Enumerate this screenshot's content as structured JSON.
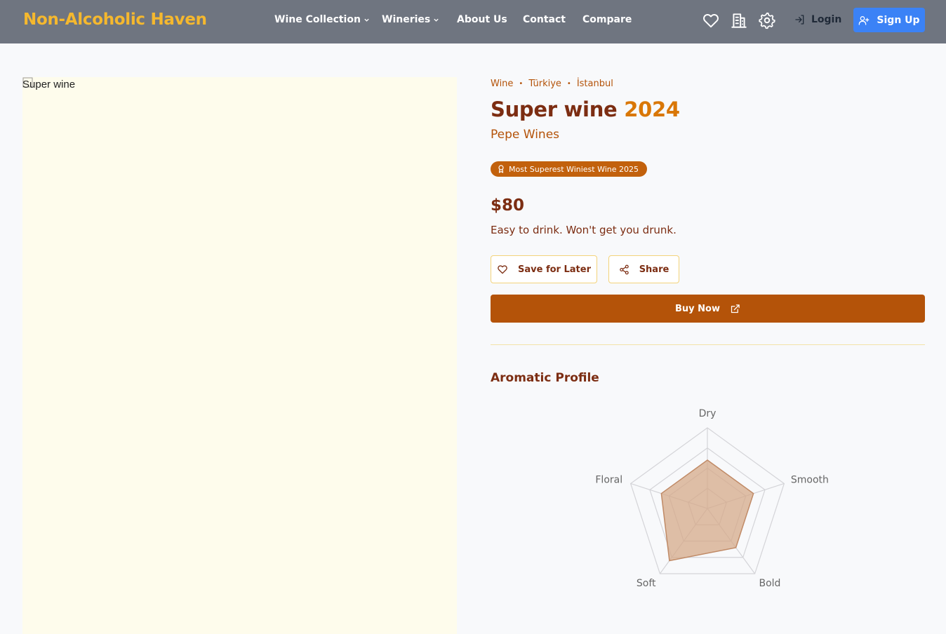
{
  "header": {
    "brand": "Non-Alcoholic Haven",
    "nav": [
      {
        "label": "Wine Collection",
        "dropdown": true
      },
      {
        "label": "Wineries",
        "dropdown": true
      },
      {
        "label": "About Us",
        "dropdown": false
      },
      {
        "label": "Contact",
        "dropdown": false
      },
      {
        "label": "Compare",
        "dropdown": false
      }
    ],
    "icons": [
      "heart-icon",
      "building-icon",
      "gear-icon"
    ],
    "login_label": "Login",
    "signup_label": "Sign Up"
  },
  "product": {
    "image_alt": "Super wine",
    "breadcrumb": [
      "Wine",
      "Türkiye",
      "İstanbul"
    ],
    "name": "Super wine",
    "year": "2024",
    "winery": "Pepe Wines",
    "award": "Most Superest Winiest Wine 2025",
    "price": "$80",
    "description": "Easy to drink. Won't get you drunk.",
    "save_label": "Save for Later",
    "share_label": "Share",
    "buy_label": "Buy Now"
  },
  "aromatic_profile": {
    "title": "Aromatic Profile"
  },
  "chart_data": {
    "type": "radar",
    "axes": [
      "Dry",
      "Smooth",
      "Bold",
      "Soft",
      "Floral"
    ],
    "values": [
      3,
      3,
      3,
      4,
      3
    ],
    "max": 5,
    "levels": 4,
    "fill_color": "#d6a98a",
    "stroke_color": "#c08a66",
    "grid_color": "#d4d4d8"
  },
  "colors": {
    "nav_bg": "#6f7580",
    "brand": "#f5b82e",
    "accent": "#b45309",
    "signup": "#3b82f6",
    "award_bg": "#c2610c",
    "image_bg": "#fefcec"
  }
}
